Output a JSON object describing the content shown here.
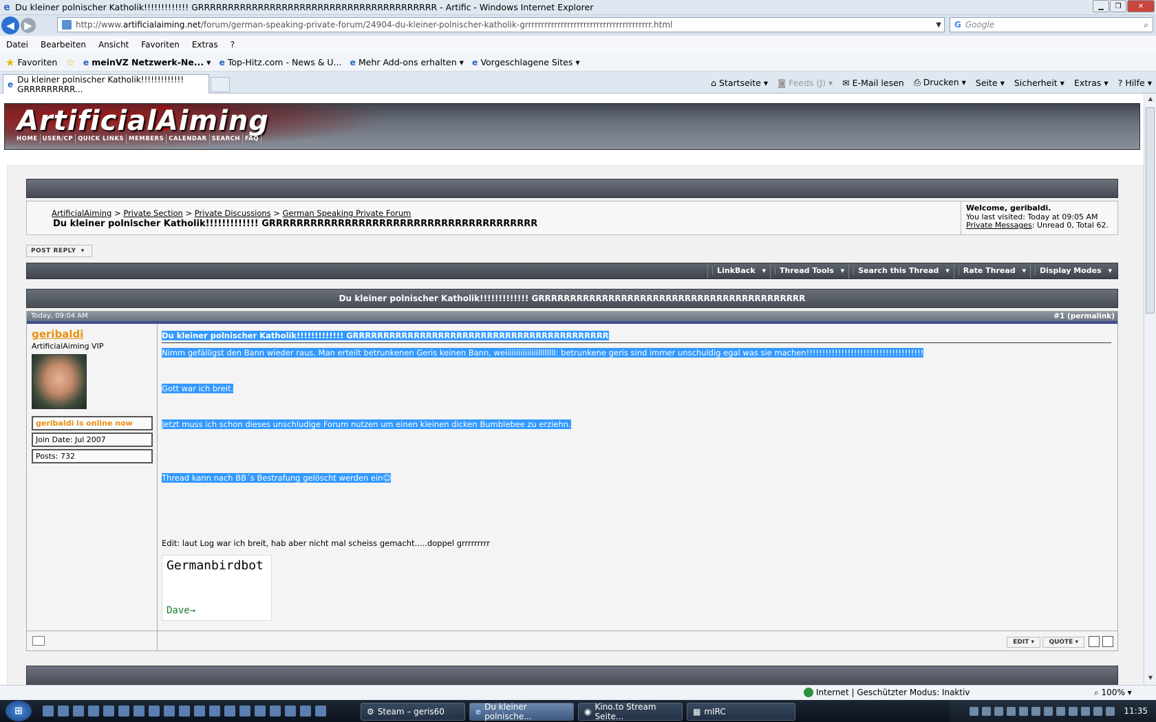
{
  "window": {
    "title": "Du kleiner polnischer Katholik!!!!!!!!!!!!! GRRRRRRRRRRRRRRRRRRRRRRRRRRRRRRRRRRRRRRRR - Artific - Windows Internet Explorer"
  },
  "address": {
    "prefix": "http://www.",
    "host": "artificialaiming.net",
    "path": "/forum/german-speaking-private-forum/24904-du-kleiner-polnischer-katholik-grrrrrrrrrrrrrrrrrrrrrrrrrrrrrrrrrrrrrrr.html"
  },
  "search": {
    "placeholder": "Google"
  },
  "menu": [
    "Datei",
    "Bearbeiten",
    "Ansicht",
    "Favoriten",
    "Extras",
    "?"
  ],
  "favorites": {
    "label": "Favoriten",
    "items": [
      "meinVZ Netzwerk-Ne...",
      "Top-Hitz.com - News & U...",
      "Mehr Add-ons erhalten",
      "Vorgeschlagene Sites"
    ]
  },
  "tab": {
    "label": "Du kleiner polnischer Katholik!!!!!!!!!!!!! GRRRRRRRRR..."
  },
  "commandbar": {
    "home": "Startseite",
    "feeds": "Feeds (J)",
    "mail": "E-Mail lesen",
    "print": "Drucken",
    "page": "Seite",
    "safety": "Sicherheit",
    "tools": "Extras",
    "help": "Hilfe"
  },
  "site": {
    "logo": "ArtificialAiming",
    "nav": [
      "HOME",
      "USER/CP",
      "QUICK LINKS",
      "MEMBERS",
      "CALENDAR",
      "SEARCH",
      "FAQ"
    ]
  },
  "breadcrumb": {
    "items": [
      "ArtificialAiming",
      "Private Section",
      "Private Discussions",
      "German Speaking Private Forum"
    ],
    "title": "Du kleiner polnischer Katholik!!!!!!!!!!!!! GRRRRRRRRRRRRRRRRRRRRRRRRRRRRRRRRRRRRRRR"
  },
  "welcome": {
    "line1": "Welcome, geribaldi.",
    "line2": "You last visited: Today at 09:05 AM",
    "pm_link": "Private Messages",
    "pm_rest": ": Unread 0, Total 62."
  },
  "post_reply": "POST REPLY",
  "thread_tools": [
    "LinkBack",
    "Thread Tools",
    "Search this Thread",
    "Rate Thread",
    "Display Modes"
  ],
  "thread_title": "Du kleiner polnischer Katholik!!!!!!!!!!!!! GRRRRRRRRRRRRRRRRRRRRRRRRRRRRRRRRRRRRRRRRRR",
  "post": {
    "date": "Today, 09:04 AM",
    "number": "#1 (permalink)",
    "user": "geribaldi",
    "user_title": "ArtificialAiming VIP",
    "online": "geribaldi is online now",
    "join_date": "Join Date: Jul 2007",
    "posts": "Posts: 732",
    "title": "Du kleiner polnischer Katholik!!!!!!!!!!!!! GRRRRRRRRRRRRRRRRRRRRRRRRRRRRRRRRRRRRRRRRRR",
    "lines": [
      "Nimm gefälligst den Bann wieder raus. Man erteilt betrunkenen Geris keinen Bann, weiiiiiiiiiiiiiiillllllll: betrunkene geris sind immer unschuldig egal was sie machen!!!!!!!!!!!!!!!!!!!!!!!!!!!!!!!!!!!!!",
      "Gott war ich breit.",
      "Jetzt muss ich schon dieses unschludige Forum nutzen um einen kleinen dicken Bumblebee zu erziehn.",
      "Thread kann nach BB´s Bestrafung gelöscht werden ein",
      "Edit: laut Log war ich breit, hab aber nicht mal scheiss gemacht.....doppel grrrrrrrrr"
    ],
    "signature_top": "Germanbirdbot",
    "signature_bottom": "Dave→",
    "edit": "EDIT",
    "quote": "QUOTE"
  },
  "status": {
    "zone": "Internet | Geschützter Modus: Inaktiv",
    "zoom": "100%"
  },
  "taskbar": {
    "items": [
      "Steam – geris60",
      "Du kleiner polnische...",
      "Kino.to Stream Seite...",
      "mIRC"
    ],
    "time": "11:35"
  }
}
